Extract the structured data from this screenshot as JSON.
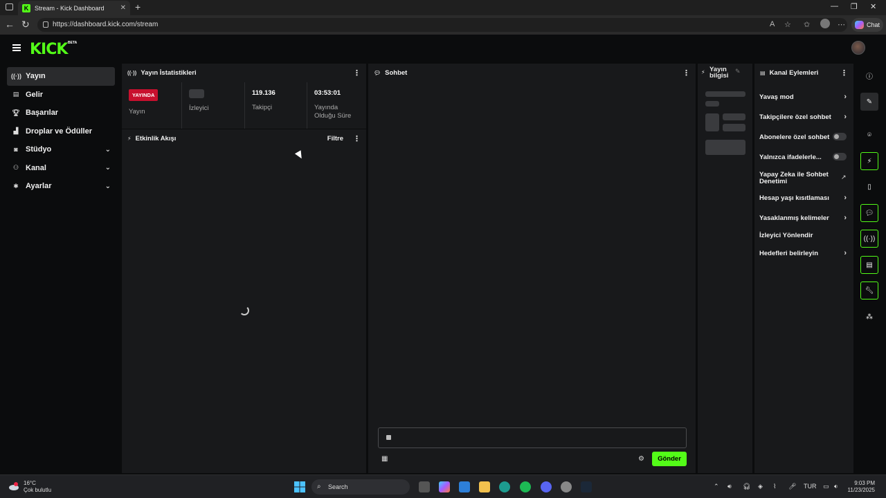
{
  "browser": {
    "tab_title": "Stream - Kick Dashboard",
    "url": "https://dashboard.kick.com/stream",
    "chat_button": "Chat"
  },
  "app": {
    "logo": "KICK",
    "logo_badge": "BETA"
  },
  "sidebar": {
    "items": [
      {
        "label": "Yayın",
        "icon": "broadcast-icon"
      },
      {
        "label": "Gelir",
        "icon": "revenue-icon"
      },
      {
        "label": "Başarılar",
        "icon": "trophy-icon"
      },
      {
        "label": "Droplar ve Ödüller",
        "icon": "gift-icon"
      },
      {
        "label": "Stüdyo",
        "icon": "studio-icon"
      },
      {
        "label": "Kanal",
        "icon": "channel-icon"
      },
      {
        "label": "Ayarlar",
        "icon": "settings-icon"
      }
    ]
  },
  "stats_panel": {
    "title": "Yayın İstatistikleri",
    "live_badge": "YAYINDA",
    "stream_label": "Yayın",
    "viewers_label": "İzleyici",
    "followers_value": "119.136",
    "followers_label": "Takipçi",
    "uptime_value": "03:53:01",
    "uptime_label": "Yayında Olduğu Süre"
  },
  "activity_panel": {
    "title": "Etkinlik Akışı",
    "filter_label": "Filtre"
  },
  "chat_panel": {
    "title": "Sohbet",
    "send_label": "Gönder"
  },
  "stream_info_panel": {
    "title": "Yayın bilgisi"
  },
  "channel_actions": {
    "title": "Kanal Eylemleri",
    "items": [
      {
        "label": "Yavaş mod",
        "control": "arrow"
      },
      {
        "label": "Takipçilere özel sohbet",
        "control": "arrow"
      },
      {
        "label": "Abonelere özel sohbet",
        "control": "toggle"
      },
      {
        "label": "Yalnızca ifadelerle...",
        "control": "toggle"
      },
      {
        "label": "Yapay Zeka ile Sohbet Denetimi",
        "control": "external"
      },
      {
        "label": "Hesap yaşı kısıtlaması",
        "control": "arrow"
      },
      {
        "label": "Yasaklanmış kelimeler",
        "control": "arrow"
      },
      {
        "label": "İzleyici Yönlendir",
        "control": "none"
      },
      {
        "label": "Hedefleri belirleyin",
        "control": "arrow"
      }
    ]
  },
  "taskbar": {
    "temperature": "16°C",
    "weather": "Çok bulutlu",
    "search_label": "Search",
    "language": "TUR",
    "time": "9:03 PM",
    "date": "11/23/2025"
  },
  "colors": {
    "accent": "#53fc18",
    "live": "#c8102e",
    "panel": "#18191b"
  }
}
